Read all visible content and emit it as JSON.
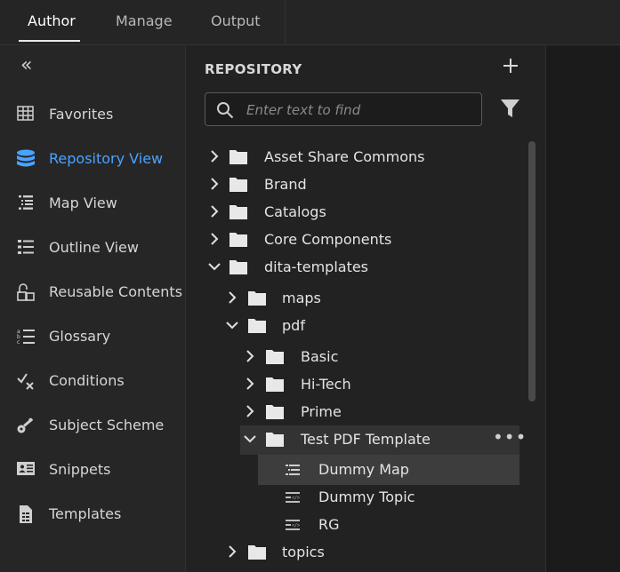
{
  "tabs": [
    {
      "label": "Author"
    },
    {
      "label": "Manage"
    },
    {
      "label": "Output"
    }
  ],
  "sidebar": {
    "collapse_glyph": "«",
    "items": [
      {
        "label": "Favorites",
        "icon": "grid-icon"
      },
      {
        "label": "Repository View",
        "icon": "database-icon",
        "active": true
      },
      {
        "label": "Map View",
        "icon": "map-list-icon"
      },
      {
        "label": "Outline View",
        "icon": "outline-list-icon"
      },
      {
        "label": "Reusable Contents",
        "icon": "reusable-icon"
      },
      {
        "label": "Glossary",
        "icon": "glossary-icon"
      },
      {
        "label": "Conditions",
        "icon": "conditions-icon"
      },
      {
        "label": "Subject Scheme",
        "icon": "key-icon"
      },
      {
        "label": "Snippets",
        "icon": "snippet-icon"
      },
      {
        "label": "Templates",
        "icon": "template-icon"
      }
    ]
  },
  "repository": {
    "title": "REPOSITORY",
    "search_placeholder": "Enter text to find",
    "tree": [
      {
        "label": "Asset Share Commons"
      },
      {
        "label": "Brand"
      },
      {
        "label": "Catalogs"
      },
      {
        "label": "Core Components"
      },
      {
        "label": "dita-templates"
      },
      {
        "label": "maps"
      },
      {
        "label": "pdf"
      },
      {
        "label": "Basic"
      },
      {
        "label": "Hi-Tech"
      },
      {
        "label": "Prime"
      },
      {
        "label": "Test PDF Template"
      },
      {
        "label": "Dummy Map"
      },
      {
        "label": "Dummy Topic"
      },
      {
        "label": "RG"
      },
      {
        "label": "topics"
      }
    ],
    "more_glyph": "•••"
  },
  "colors": {
    "accent": "#4aa3ff",
    "background": "#1e1e1e",
    "sidebar_bg": "#262626",
    "panel_bg": "#222222"
  }
}
